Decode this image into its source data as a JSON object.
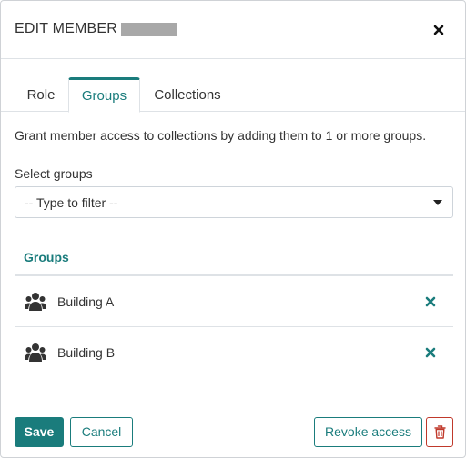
{
  "header": {
    "title": "EDIT MEMBER"
  },
  "tabs": [
    {
      "label": "Role",
      "active": false
    },
    {
      "label": "Groups",
      "active": true
    },
    {
      "label": "Collections",
      "active": false
    }
  ],
  "content": {
    "intro": "Grant member access to collections by adding them to 1 or more groups.",
    "select_label": "Select groups",
    "select_placeholder": "-- Type to filter --"
  },
  "groups": {
    "heading": "Groups",
    "items": [
      {
        "name": "Building A",
        "icon": "users-icon",
        "remove_icon": "remove-icon"
      },
      {
        "name": "Building B",
        "icon": "users-icon",
        "remove_icon": "remove-icon"
      }
    ]
  },
  "footer": {
    "save_label": "Save",
    "cancel_label": "Cancel",
    "revoke_label": "Revoke access",
    "delete_icon": "trash-icon"
  },
  "colors": {
    "accent": "#1a7c7c",
    "danger": "#c0392b",
    "border": "#dee2e6",
    "text": "#333333"
  }
}
